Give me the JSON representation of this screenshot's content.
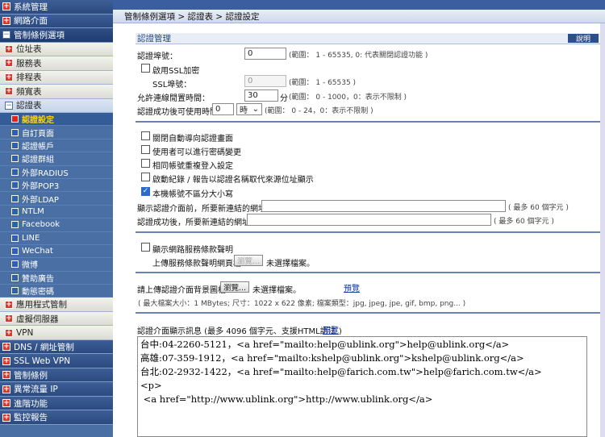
{
  "sidebar": {
    "top_items": [
      {
        "label": "系統管理",
        "icon": "plus-icon"
      },
      {
        "label": "網路介面",
        "icon": "plus-icon"
      },
      {
        "label": "管制條例選項",
        "icon": "minus-icon"
      }
    ],
    "sub_items": [
      {
        "label": "位址表"
      },
      {
        "label": "服務表"
      },
      {
        "label": "排程表"
      },
      {
        "label": "頻寬表"
      },
      {
        "label": "認證表"
      }
    ],
    "leaves": [
      {
        "label": "認證設定",
        "active": true
      },
      {
        "label": "自訂頁面"
      },
      {
        "label": "認證帳戶"
      },
      {
        "label": "認證群組"
      },
      {
        "label": "外部RADIUS"
      },
      {
        "label": "外部POP3"
      },
      {
        "label": "外部LDAP"
      },
      {
        "label": "NTLM"
      },
      {
        "label": "Facebook"
      },
      {
        "label": "LINE"
      },
      {
        "label": "WeChat"
      },
      {
        "label": "微博"
      },
      {
        "label": "贊助廣告"
      },
      {
        "label": "動態密碼"
      }
    ],
    "sub_items_after": [
      {
        "label": "應用程式管制"
      },
      {
        "label": "虛擬伺服器"
      },
      {
        "label": "VPN"
      }
    ],
    "bottom_items": [
      {
        "label": "DNS / 網址管制"
      },
      {
        "label": "SSL Web VPN"
      },
      {
        "label": "管制條例"
      },
      {
        "label": "異常流量 IP"
      },
      {
        "label": "進階功能"
      },
      {
        "label": "監控報告"
      }
    ]
  },
  "breadcrumb": "管制條例選項 > 認證表 > 認證設定",
  "section": {
    "title": "認證管理",
    "help_label": "說明"
  },
  "form": {
    "auth_port_label": "認證埠號：",
    "auth_port_value": "0",
    "auth_port_hint": "(範圍： 1 - 65535, 0: 代表關閉認證功能 )",
    "ssl_enable_label": "啟用SSL加密",
    "ssl_port_label": "SSL埠號：",
    "ssl_port_value": "0",
    "ssl_port_hint": "(範圍： 1 - 65535 )",
    "idle_label": "允許連線閒置時間：",
    "idle_value": "30",
    "idle_unit": "分",
    "idle_hint": "(範圍： 0 - 1000，0：表示不限制 )",
    "usable_label": "認證成功後可使用時間",
    "usable_value": "0",
    "usable_unit": "時",
    "usable_hint": "(範圍： 0 - 24，0：表示不限制 )"
  },
  "options": [
    {
      "label": "關閉自動導向認證畫面",
      "checked": false
    },
    {
      "label": "使用者可以進行密碼變更",
      "checked": false
    },
    {
      "label": "相同帳號重複登入設定",
      "checked": false
    },
    {
      "label": "啟動紀錄 / 報告以認證名稱取代來源位址顯示",
      "checked": false
    },
    {
      "label": "本機帳號不區分大小寫",
      "checked": true
    }
  ],
  "redirect": {
    "before_label": "顯示認證介面前，所要新連結的網址：",
    "before_hint": "( 最多 60 個字元 )",
    "after_label": "認證成功後，所要新連結的網址：",
    "after_hint": "( 最多 60 個字元 )"
  },
  "terms": {
    "show_label": "顯示網路服務條款聲明",
    "upload_label": "上傳服務條款聲明網頁檔",
    "browse_label": "瀏覽...",
    "no_file": "未選擇檔案。"
  },
  "bg_image": {
    "label": "請上傳認證介面背景圖檔",
    "browse_label": "瀏覽...",
    "no_file": "未選擇檔案。",
    "preview_label": "預覽",
    "hint": "( 最大檔案大小：1 MBytes; 尺寸：1022 x 622 像素; 檔案類型：jpg, jpeg, jpe, gif, bmp, png... )"
  },
  "message": {
    "label": "認證介面顯示訊息 (最多 4096 個字元、支援HTML語法 )",
    "preview_label": "預覽",
    "content": "台中:04-2260-5121，<a href=\"mailto:help@ublink.org\">help@ublink.org</a>\n高雄:07-359-1912，<a href=\"mailto:kshelp@ublink.org\">kshelp@ublink.org</a>\n台北:02-2932-1422，<a href=\"mailto:help@farich.com.tw\">help@farich.com.tw</a>\n<p>\n <a href=\"http://www.ublink.org\">http://www.ublink.org</a>"
  }
}
